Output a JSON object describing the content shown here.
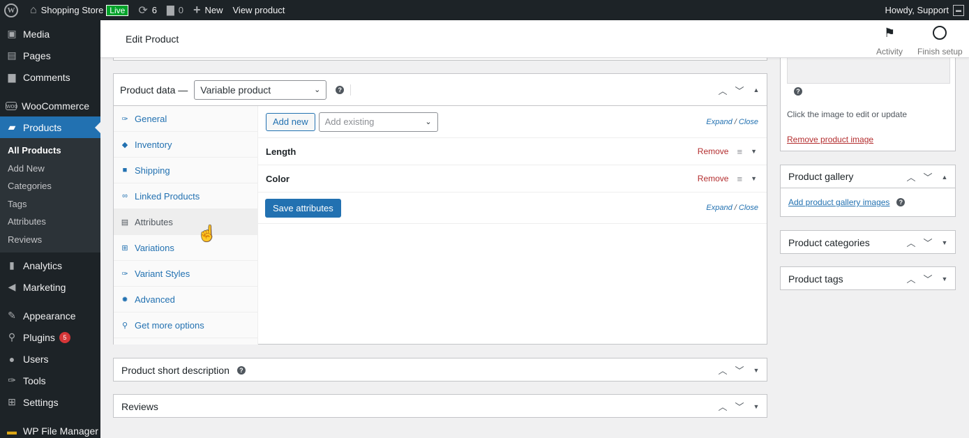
{
  "admin_bar": {
    "site_name": "Shopping Store",
    "live_badge": "Live",
    "updates_count": "6",
    "comments_count": "0",
    "new_label": "New",
    "view_product": "View product",
    "howdy": "Howdy, Support"
  },
  "sidebar": {
    "items_top": [
      {
        "label": "Media",
        "icon": "media-icon"
      },
      {
        "label": "Pages",
        "icon": "pages-icon"
      },
      {
        "label": "Comments",
        "icon": "comments-icon"
      }
    ],
    "woocommerce": "WooCommerce",
    "products": "Products",
    "submenu": [
      "All Products",
      "Add New",
      "Categories",
      "Tags",
      "Attributes",
      "Reviews"
    ],
    "analytics": "Analytics",
    "marketing": "Marketing",
    "appearance": "Appearance",
    "plugins": "Plugins",
    "plugins_badge": "5",
    "users": "Users",
    "tools": "Tools",
    "settings": "Settings",
    "wp_file_manager": "WP File Manager"
  },
  "header": {
    "title": "Edit Product",
    "activity": "Activity",
    "finish_setup": "Finish setup"
  },
  "product_data": {
    "label": "Product data —",
    "type_select": "Variable product",
    "tabs": [
      "General",
      "Inventory",
      "Shipping",
      "Linked Products",
      "Attributes",
      "Variations",
      "Variant Styles",
      "Advanced",
      "Get more options"
    ],
    "add_new": "Add new",
    "add_existing_placeholder": "Add existing",
    "expand": "Expand",
    "separator": "/",
    "close": "Close",
    "attributes": [
      {
        "name": "Length",
        "remove": "Remove"
      },
      {
        "name": "Color",
        "remove": "Remove"
      }
    ],
    "save_attributes": "Save attributes"
  },
  "short_description": {
    "title": "Product short description"
  },
  "reviews": {
    "title": "Reviews"
  },
  "right": {
    "image_hint": "Click the image to edit or update",
    "remove_image": "Remove product image",
    "gallery_title": "Product gallery",
    "gallery_link": "Add product gallery images",
    "categories_title": "Product categories",
    "tags_title": "Product tags"
  }
}
